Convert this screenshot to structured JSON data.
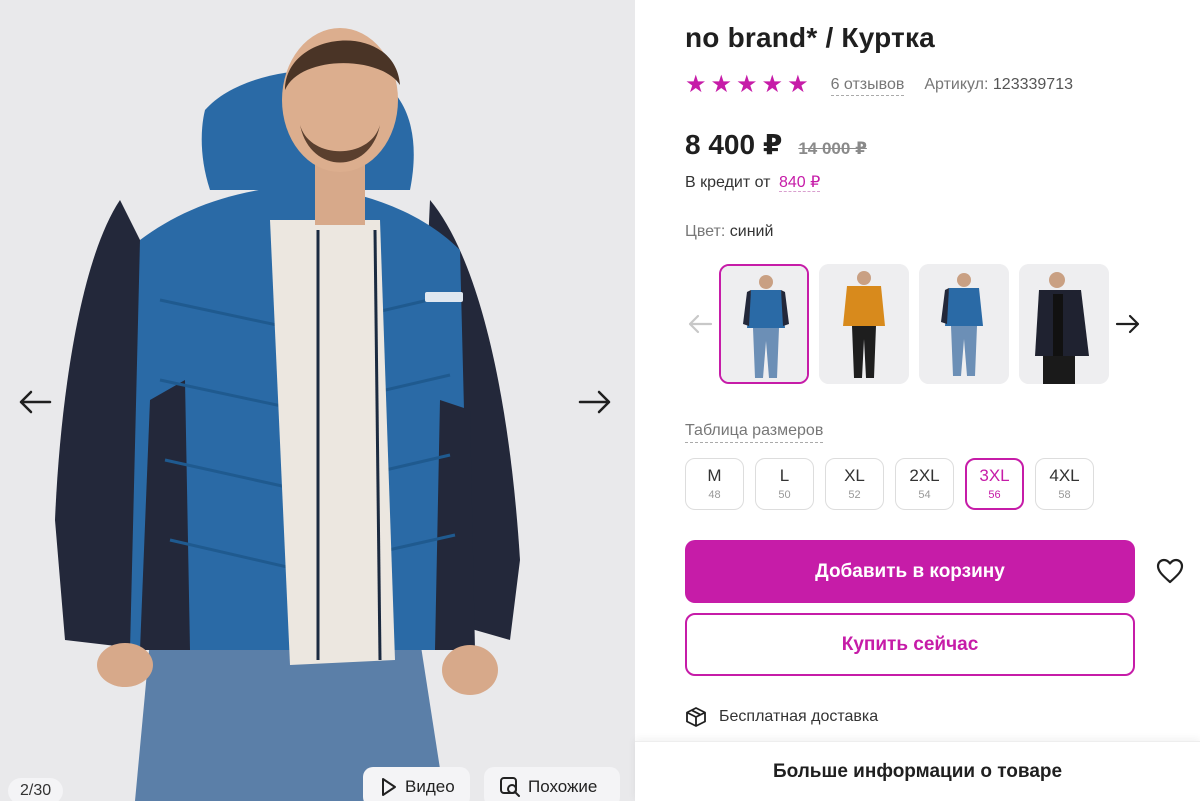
{
  "gallery": {
    "counter": "2/30",
    "video_label": "Видео",
    "similar_label": "Похожие"
  },
  "product": {
    "title": "no brand* / Куртка",
    "rating_stars": 5,
    "reviews": "6 отзывов",
    "article_label": "Артикул:",
    "article_number": "123339713",
    "price": "8 400 ₽",
    "old_price": "14 000 ₽",
    "credit_label": "В кредит от",
    "credit_amount": "840 ₽",
    "color_label": "Цвет:",
    "color_value": "синий",
    "variants": [
      {
        "name": "blue-jacket-front",
        "active": true
      },
      {
        "name": "orange-jacket",
        "active": false
      },
      {
        "name": "blue-jacket-side",
        "active": false
      },
      {
        "name": "black-jacket",
        "active": false
      }
    ],
    "size_table_label": "Таблица размеров",
    "sizes": [
      {
        "label": "M",
        "ru": "48"
      },
      {
        "label": "L",
        "ru": "50"
      },
      {
        "label": "XL",
        "ru": "52"
      },
      {
        "label": "2XL",
        "ru": "54"
      },
      {
        "label": "3XL",
        "ru": "56"
      },
      {
        "label": "4XL",
        "ru": "58"
      }
    ],
    "selected_size": "3XL",
    "add_to_cart": "Добавить в корзину",
    "buy_now": "Купить сейчас",
    "delivery": "Бесплатная доставка",
    "more_info": "Больше информации о товаре"
  },
  "colors": {
    "accent": "#c61ca8",
    "jacket_blue": "#2a6aa6",
    "jacket_dark": "#23283a"
  }
}
